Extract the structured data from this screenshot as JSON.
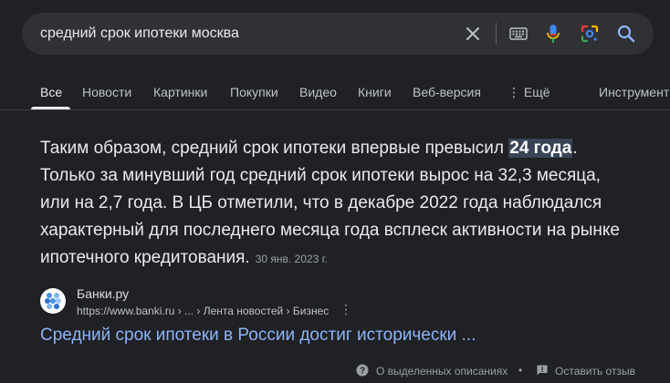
{
  "search": {
    "query": "средний срок ипотеки москва"
  },
  "tabs": [
    {
      "label": "Все",
      "active": true
    },
    {
      "label": "Новости"
    },
    {
      "label": "Картинки"
    },
    {
      "label": "Покупки"
    },
    {
      "label": "Видео"
    },
    {
      "label": "Книги"
    },
    {
      "label": "Веб-версия"
    },
    {
      "label": "⋮ Ещё"
    },
    {
      "label": "Инструменты"
    }
  ],
  "snippet": {
    "text_before": "Таким образом, средний срок ипотеки впервые превысил ",
    "highlight": "24 года",
    "text_after": ". Только за минувший год средний срок ипотеки вырос на 32,3 месяца, или на 2,7 года. В ЦБ отметили, что в декабре 2022 года наблюдался характерный для последнего месяца года всплеск активности на рынке ипотечного кредитования.",
    "date": "30 янв. 2023 г.",
    "highlight_color": "#394457"
  },
  "source": {
    "site_name": "Банки.ру",
    "url": "https://www.banki.ru › ... › Лента новостей › Бизнес",
    "title": "Средний срок ипотеки в России достиг исторически ...",
    "link_color": "#8ab4f8"
  },
  "footer": {
    "about": "О выделенных описаниях",
    "separator": "•",
    "feedback": "Оставить отзыв"
  },
  "icons": {
    "clear": "close-icon",
    "keyboard": "keyboard-icon",
    "mic": "microphone-icon",
    "lens": "lens-icon",
    "search": "search-icon"
  }
}
